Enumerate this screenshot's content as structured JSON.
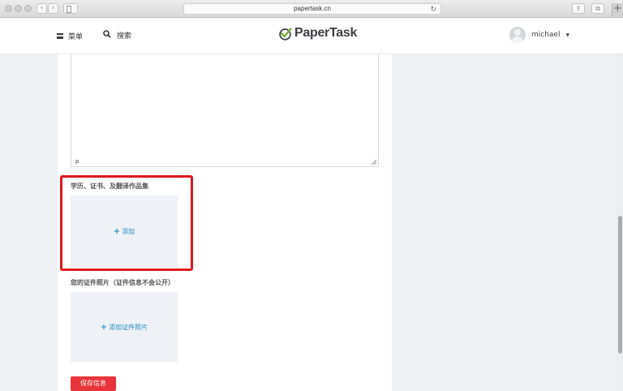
{
  "browser": {
    "url": "papertask.cn",
    "back_glyph": "‹",
    "forward_glyph": "›",
    "reload_glyph": "↻",
    "share_glyph": "⇪",
    "tabs_glyph": "⧉",
    "newtab_glyph": "+"
  },
  "header": {
    "menu_label": "菜单",
    "search_label": "搜索",
    "search_glyph": "⚲",
    "logo_text": "PaperTask",
    "username": "michael",
    "caret": "▼"
  },
  "form": {
    "textarea_status": "p",
    "credentials_section_label": "学历、证书、及翻译作品集",
    "credentials_add_label": "添加",
    "id_photos_section_label": "您的证件照片（证件信息不会公开）",
    "id_photos_add_label": "添加证件照片",
    "plus_glyph": "+",
    "save_button_label": "保存信息"
  },
  "colors": {
    "accent_red": "#e8343a",
    "highlight_red": "#e0161e",
    "link_blue": "#2a8fc4",
    "logo_green": "#7cb342"
  },
  "icons": [
    "hamburger-icon",
    "search-icon",
    "papertask-logo-icon",
    "avatar",
    "caret-down-icon",
    "plus-icon",
    "resize-grip-icon"
  ]
}
